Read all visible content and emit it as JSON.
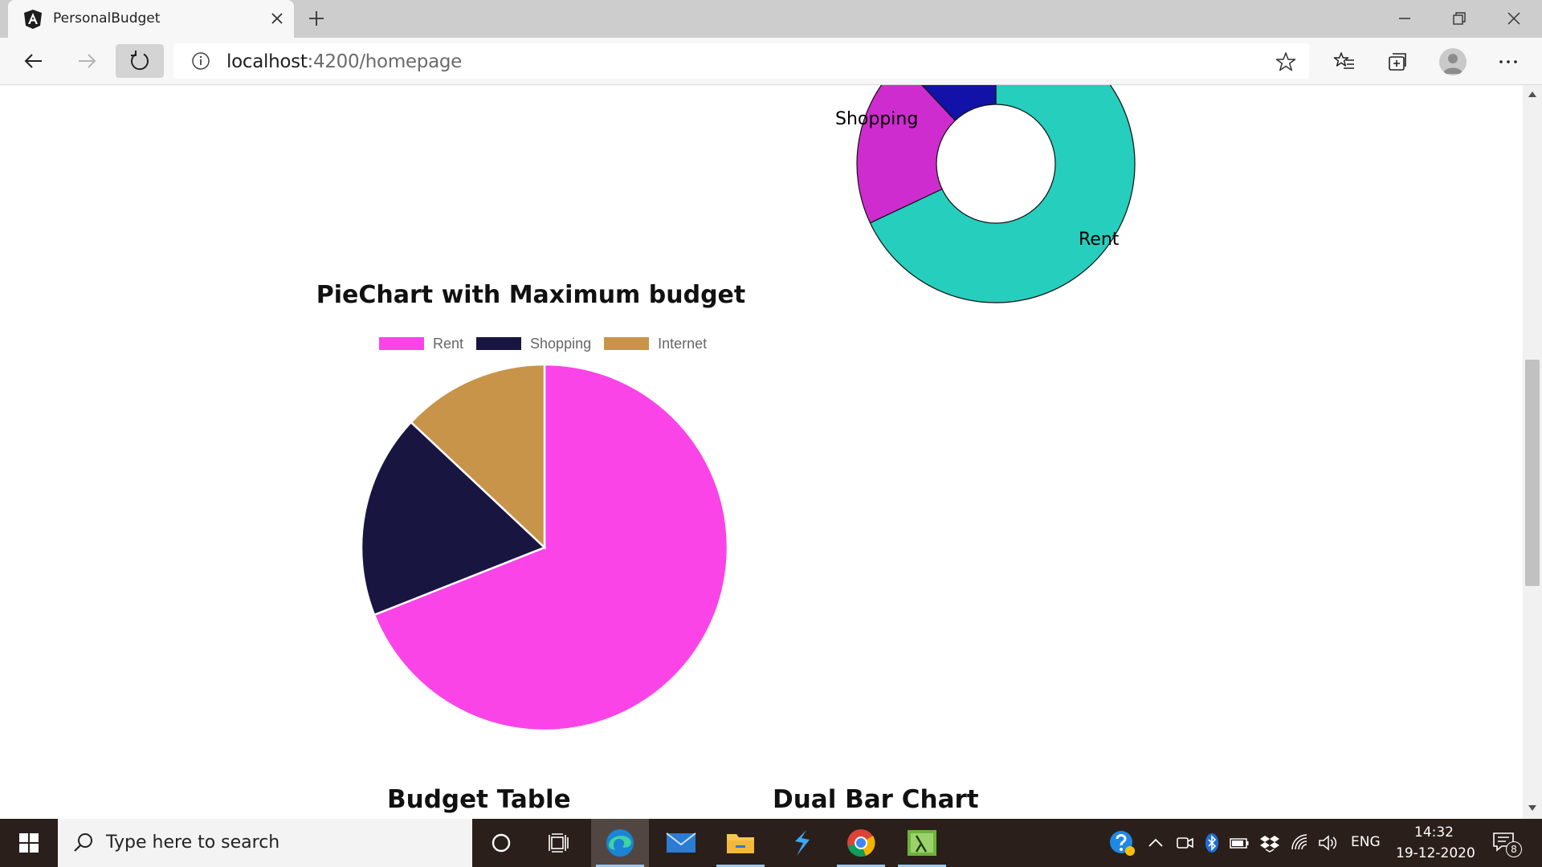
{
  "browser": {
    "tab_title": "PersonalBudget",
    "url_host": "localhost",
    "url_rest": ":4200/homepage"
  },
  "donut": {
    "labels": [
      "Shopping",
      "Rent"
    ],
    "colors": {
      "rent": "#26cebd",
      "shopping": "#cf2ccf",
      "internet": "#1212a8"
    }
  },
  "pie_chart": {
    "title": "PieChart with Maximum budget",
    "legend": [
      {
        "label": "Rent",
        "color": "#fa44e8"
      },
      {
        "label": "Shopping",
        "color": "#191541"
      },
      {
        "label": "Internet",
        "color": "#c7944a"
      }
    ]
  },
  "chart_data": [
    {
      "type": "pie",
      "title": "PieChart with Maximum budget",
      "categories": [
        "Rent",
        "Shopping",
        "Internet"
      ],
      "values": [
        69,
        18,
        13
      ],
      "colors": [
        "#fa44e8",
        "#191541",
        "#c7944a"
      ],
      "legend_position": "top"
    },
    {
      "type": "pie",
      "title": "",
      "categories": [
        "Rent",
        "Shopping",
        "Internet"
      ],
      "values": [
        68,
        20,
        12
      ],
      "colors": [
        "#26cebd",
        "#cf2ccf",
        "#1212a8"
      ]
    }
  ],
  "sections": {
    "budget_table": "Budget Table",
    "dual_bar_chart": "Dual Bar Chart"
  },
  "taskbar": {
    "search_placeholder": "Type here to search",
    "language": "ENG",
    "time": "14:32",
    "date": "19-12-2020",
    "notification_count": "8"
  }
}
